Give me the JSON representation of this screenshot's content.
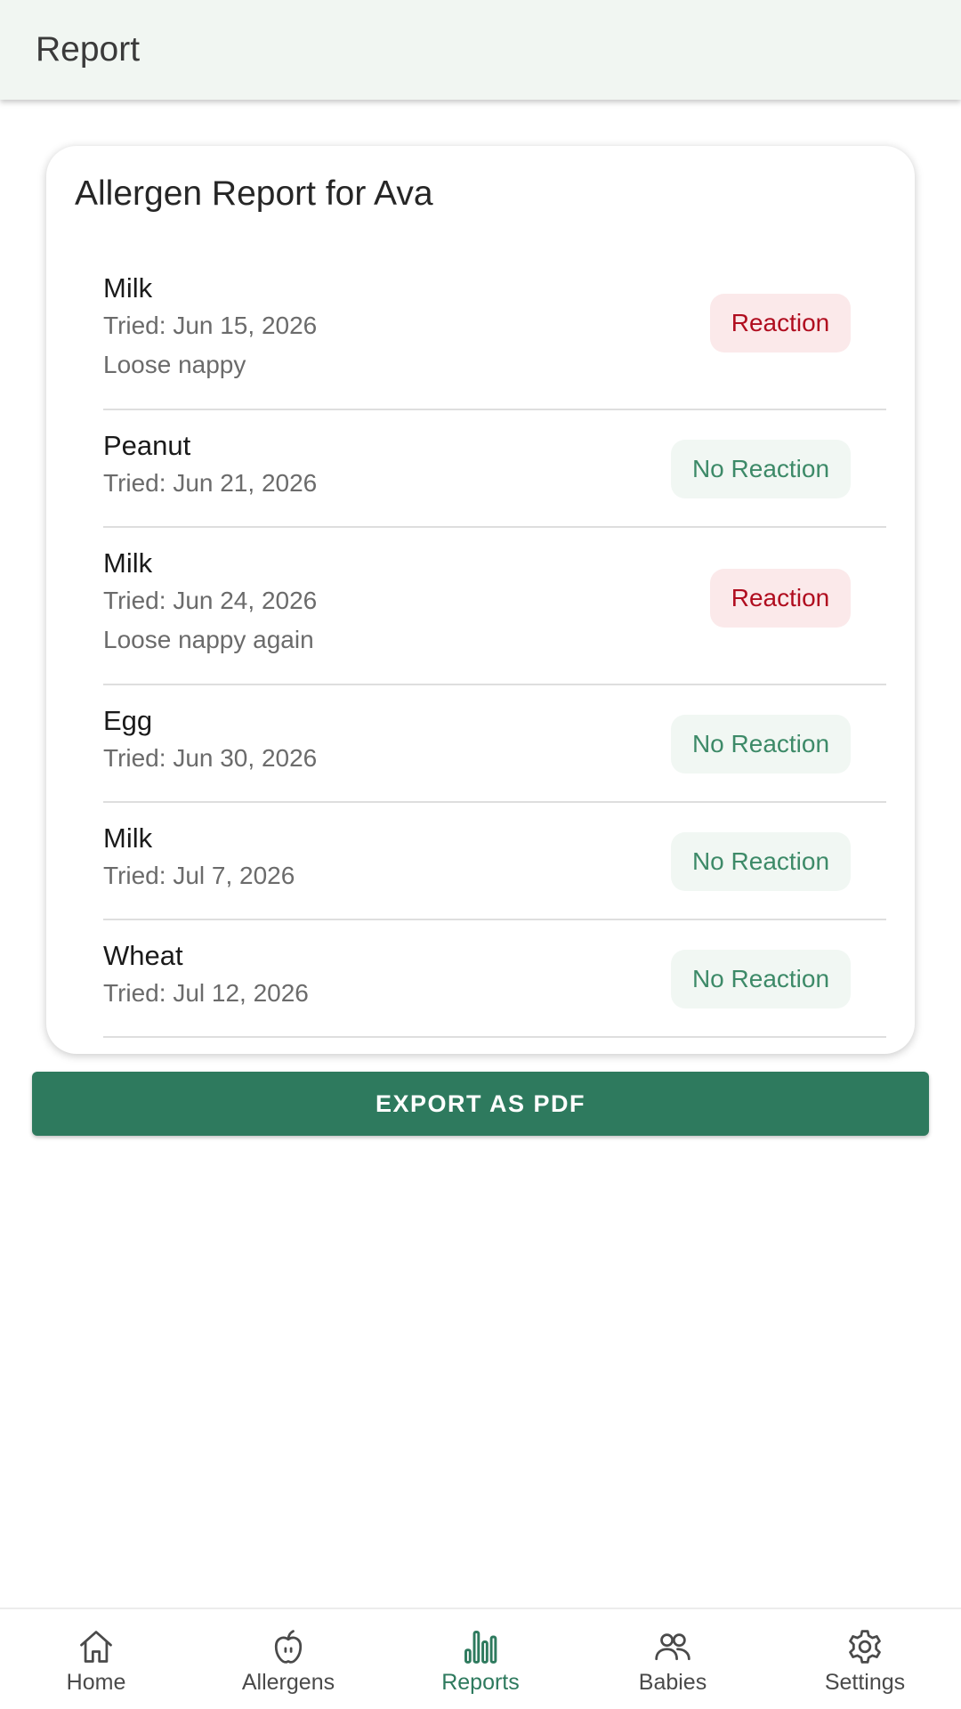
{
  "app_bar": {
    "title": "Report"
  },
  "report": {
    "title": "Allergen Report for Ava",
    "entries": [
      {
        "allergen": "Milk",
        "tried": "Tried: Jun 15, 2026",
        "note": "Loose nappy",
        "status": "Reaction"
      },
      {
        "allergen": "Peanut",
        "tried": "Tried: Jun 21, 2026",
        "status": "No Reaction"
      },
      {
        "allergen": "Milk",
        "tried": "Tried: Jun 24, 2026",
        "note": "Loose nappy again",
        "status": "Reaction"
      },
      {
        "allergen": "Egg",
        "tried": "Tried: Jun 30, 2026",
        "status": "No Reaction"
      },
      {
        "allergen": "Milk",
        "tried": "Tried: Jul 7, 2026",
        "status": "No Reaction"
      },
      {
        "allergen": "Wheat",
        "tried": "Tried: Jul 12, 2026",
        "status": "No Reaction"
      }
    ]
  },
  "export": {
    "label": "EXPORT AS PDF"
  },
  "nav": {
    "items": [
      {
        "label": "Home",
        "icon": "home-icon"
      },
      {
        "label": "Allergens",
        "icon": "apple-icon"
      },
      {
        "label": "Reports",
        "icon": "bar-chart-icon",
        "active": true
      },
      {
        "label": "Babies",
        "icon": "people-icon"
      },
      {
        "label": "Settings",
        "icon": "gear-icon"
      }
    ]
  },
  "colors": {
    "primary": "#2e7a5e",
    "app_bar_bg": "#f1f6f2",
    "reaction_text": "#b00d1f",
    "reaction_bg": "#fbe9ea",
    "no_reaction_text": "#3d8a68",
    "no_reaction_bg": "#f1f7f3"
  }
}
